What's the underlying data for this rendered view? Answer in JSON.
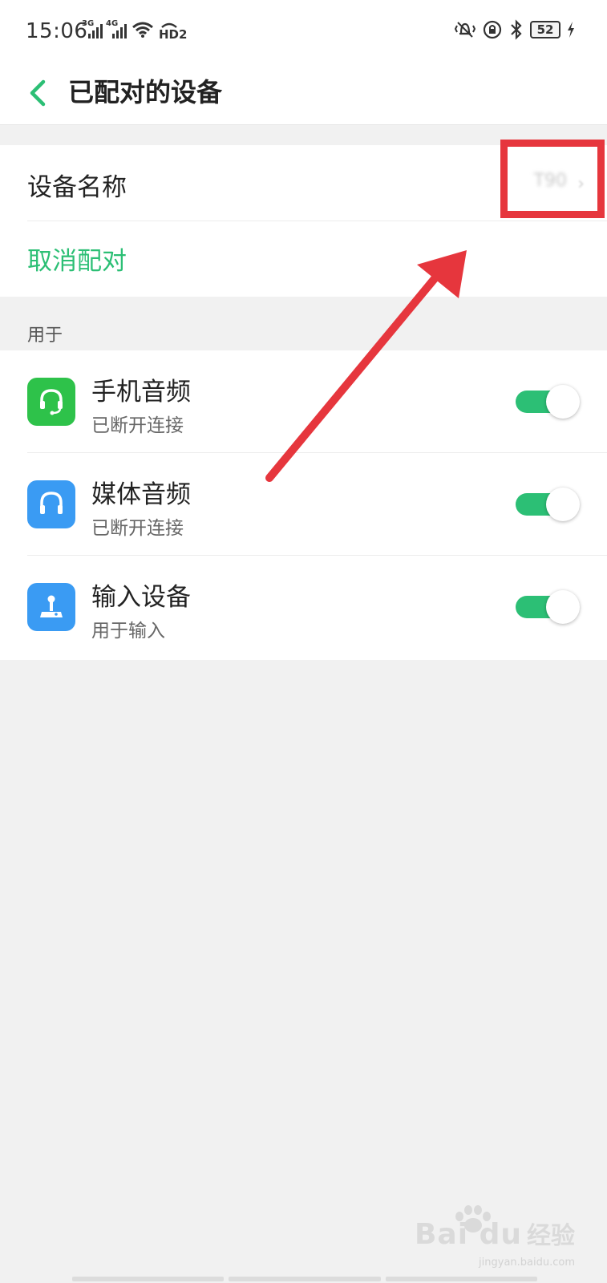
{
  "status_bar": {
    "time": "15:06",
    "sig1_tag": "3G",
    "sig2_tag": "4G",
    "hd_label": "HD2",
    "battery": "52"
  },
  "header": {
    "title": "已配对的设备"
  },
  "device": {
    "name_label": "设备名称",
    "name_value": "T90",
    "unpair_label": "取消配对"
  },
  "section_label": "用于",
  "profiles": [
    {
      "title": "手机音频",
      "subtitle": "已断开连接",
      "enabled": true,
      "icon": "headset-mic-icon",
      "color": "#2ec24a"
    },
    {
      "title": "媒体音频",
      "subtitle": "已断开连接",
      "enabled": true,
      "icon": "headphones-icon",
      "color": "#3a9bf3"
    },
    {
      "title": "输入设备",
      "subtitle": "用于输入",
      "enabled": true,
      "icon": "joystick-icon",
      "color": "#3a9bf3"
    }
  ],
  "colors": {
    "accent": "#2cbf75",
    "annotation": "#e6363d"
  },
  "watermark": {
    "logo": "Bai du",
    "text": "经验",
    "url": "jingyan.baidu.com"
  }
}
